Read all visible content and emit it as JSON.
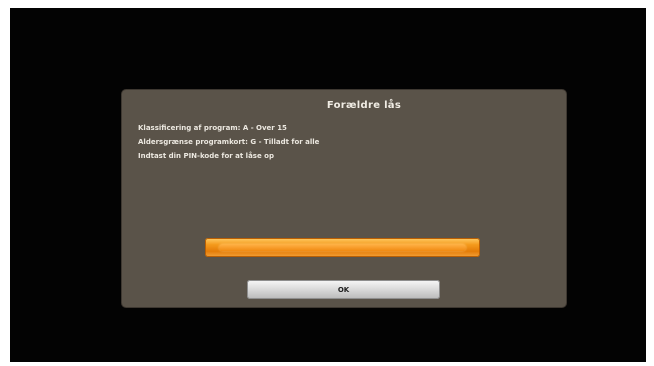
{
  "dialog": {
    "title": "Forældre lås",
    "lines": [
      "Klassificering af program: A - Over 15",
      "Aldersgrænse programkort: G - Tilladt for alle",
      "Indtast din PIN-kode for at låse op"
    ],
    "pin_input_value": "",
    "ok_label": "OK"
  },
  "colors": {
    "background": "#030303",
    "dialog": "#5a5349",
    "pin_field": "#f49a1c",
    "ok_button": "#d6d6d6"
  }
}
